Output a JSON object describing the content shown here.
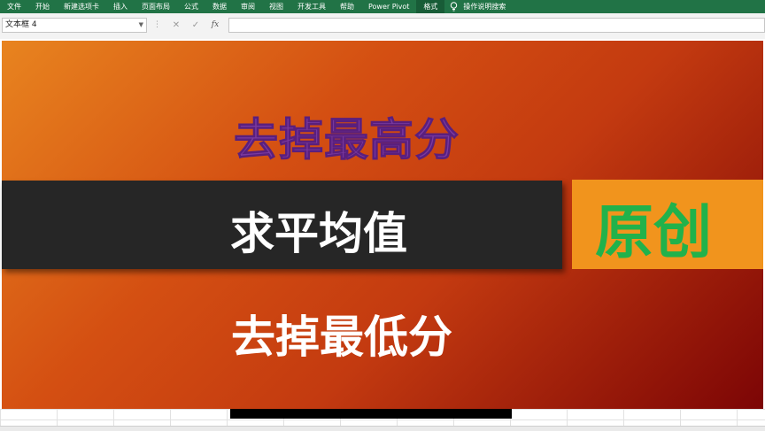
{
  "ribbon": {
    "tabs": [
      {
        "label": "文件",
        "active": false
      },
      {
        "label": "开始",
        "active": false
      },
      {
        "label": "新建选项卡",
        "active": false
      },
      {
        "label": "插入",
        "active": false
      },
      {
        "label": "页面布局",
        "active": false
      },
      {
        "label": "公式",
        "active": false
      },
      {
        "label": "数据",
        "active": false
      },
      {
        "label": "审阅",
        "active": false
      },
      {
        "label": "视图",
        "active": false
      },
      {
        "label": "开发工具",
        "active": false
      },
      {
        "label": "帮助",
        "active": false
      },
      {
        "label": "Power Pivot",
        "active": false
      },
      {
        "label": "格式",
        "active": true
      }
    ],
    "tell_me": "操作说明搜索",
    "accent": "#217346"
  },
  "formula_bar": {
    "name_box": "文本框 4",
    "cancel_symbol": "✕",
    "enter_symbol": "✓",
    "fx_symbol": "fx",
    "formula": ""
  },
  "slide": {
    "title_top": "去掉最高分",
    "band_text": "求平均值",
    "badge_text": "原创",
    "title_bottom": "去掉最低分",
    "colors": {
      "gradient_start": "#e8841f",
      "gradient_end": "#7c0505",
      "band": "#262626",
      "badge_bg": "#f1941d",
      "badge_text": "#21b24b",
      "title_top": "#7b3aa0"
    }
  }
}
